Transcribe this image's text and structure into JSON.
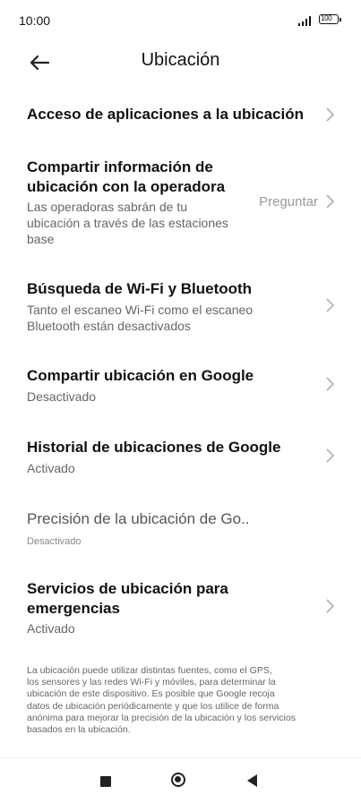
{
  "status_bar": {
    "time": "10:00",
    "battery": "100"
  },
  "header": {
    "title": "Ubicación"
  },
  "items": [
    {
      "title": "Acceso de aplicaciones a la ubicación"
    },
    {
      "title_line1": "Compartir información de",
      "title_line2": "ubicación con la operadora",
      "sub_line1": "Las operadoras sabrán de tu",
      "sub_line2": "ubicación a través de las estaciones",
      "sub_line3": "base",
      "value": "Preguntar"
    },
    {
      "title": "Búsqueda de Wi-Fi y Bluetooth",
      "sub_line1": "Tanto el escaneo Wi-Fi como el escaneo",
      "sub_line2": "Bluetooth están desactivados"
    },
    {
      "title": "Compartir ubicación en Google",
      "sub": "Desactivado"
    },
    {
      "title": "Historial de ubicaciones de Google",
      "sub": "Activado"
    },
    {
      "title": "Precisión de la ubicación de Go..",
      "sub": "Desactivado"
    },
    {
      "title_line1": "Servicios de ubicación para",
      "title_line2": "emergencias",
      "sub": "Activado"
    }
  ],
  "footer": {
    "line1": "La ubicación puede utilizar distintas fuentes, como el GPS,",
    "line2": "los sensores y las redes Wi-Fi y móviles, para determinar la",
    "line3": "ubicación de este dispositivo. Es posible que Google recoja",
    "line4": "datos de ubicación periódicamente y que los utilice de forma",
    "line5": "anónima para mejorar la precisión de la ubicación y los servicios",
    "line6": "basados en la ubicación."
  },
  "icons": {
    "back": "arrow-left-icon",
    "chevron": "chevron-right-icon",
    "nav": [
      "square-icon",
      "circle-home-icon",
      "triangle-back-icon"
    ]
  },
  "colors": {
    "background": "#ffffff",
    "title": "#111111",
    "subtitle": "#666666",
    "chevron": "#b0b0b0"
  }
}
